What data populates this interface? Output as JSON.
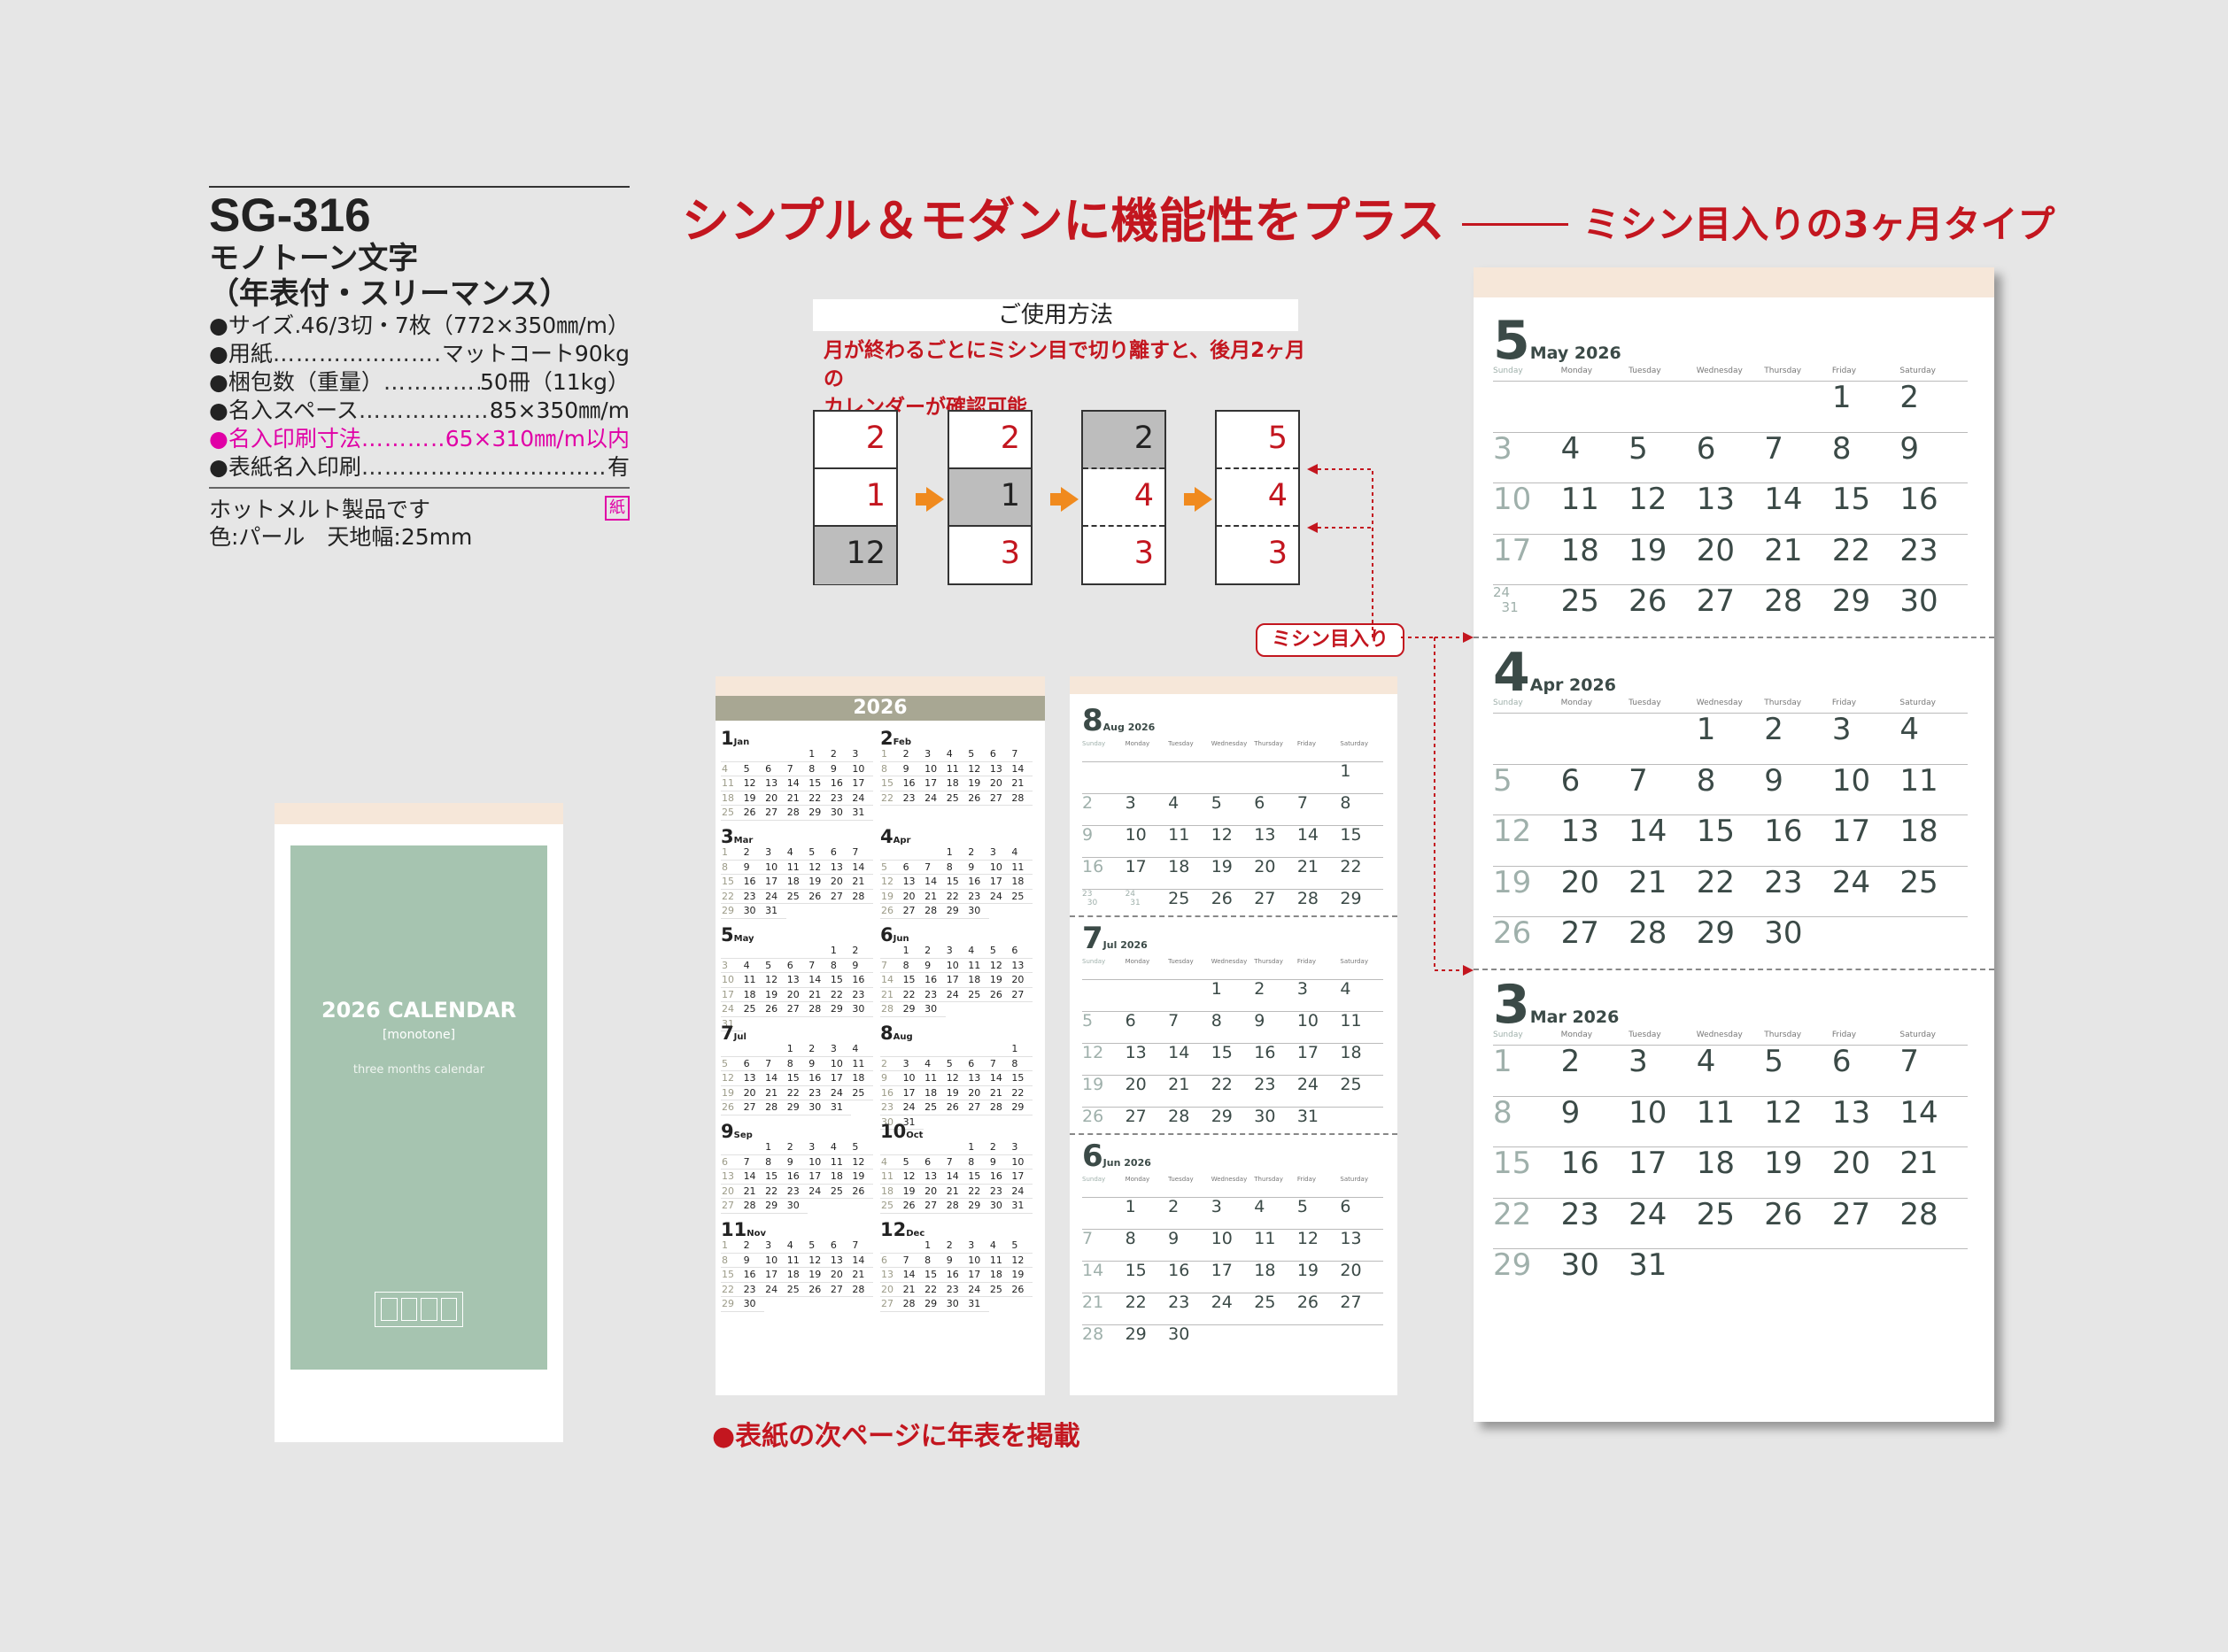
{
  "spec": {
    "code": "SG-316",
    "title1": "モノトーン文字",
    "title2": "（年表付・スリーマンス）",
    "rows": [
      {
        "key": "●サイズ",
        "value": "46/3切・7枚（772×350㎜/m）"
      },
      {
        "key": "●用紙",
        "value": "マットコート90kg"
      },
      {
        "key": "●梱包数（重量）",
        "value": "50冊（11kg）"
      },
      {
        "key": "●名入スペース",
        "value": "85×350㎜/m"
      },
      {
        "key": "●名入印刷寸法",
        "value": "65×310㎜/m以内",
        "highlight": true
      },
      {
        "key": "●表紙名入印刷",
        "value": "有"
      }
    ],
    "note1": "ホットメルト製品です",
    "note2": "色:パール　天地幅:25mm",
    "badge": "紙"
  },
  "headline": {
    "main": "シンプル＆モダンに機能性をプラス",
    "sub": "ミシン目入りの3ヶ月タイプ"
  },
  "usage": {
    "title": "ご使用方法",
    "desc1": "月が終わるごとにミシン目で切り離すと、後月2ヶ月の",
    "desc2": "カレンダーが確認可能",
    "perforation_label": "ミシン目入り",
    "steps": [
      [
        "2",
        "1",
        "12"
      ],
      [
        "2",
        "1",
        "3"
      ],
      [
        "2",
        "4",
        "3"
      ],
      [
        "5",
        "4",
        "3"
      ]
    ]
  },
  "cover": {
    "title": "2026 CALENDAR",
    "brand": "[monotone]",
    "subtitle": "three months calendar"
  },
  "year_sheet": {
    "year": "2026",
    "months": [
      {
        "n": "1",
        "e": "Jan",
        "offset": 4,
        "days": 31
      },
      {
        "n": "2",
        "e": "Feb",
        "offset": 0,
        "days": 28
      },
      {
        "n": "3",
        "e": "Mar",
        "offset": 0,
        "days": 31
      },
      {
        "n": "4",
        "e": "Apr",
        "offset": 3,
        "days": 30
      },
      {
        "n": "5",
        "e": "May",
        "offset": 5,
        "days": 31
      },
      {
        "n": "6",
        "e": "Jun",
        "offset": 1,
        "days": 30
      },
      {
        "n": "7",
        "e": "Jul",
        "offset": 3,
        "days": 31
      },
      {
        "n": "8",
        "e": "Aug",
        "offset": 6,
        "days": 31
      },
      {
        "n": "9",
        "e": "Sep",
        "offset": 2,
        "days": 30
      },
      {
        "n": "10",
        "e": "Oct",
        "offset": 4,
        "days": 31
      },
      {
        "n": "11",
        "e": "Nov",
        "offset": 0,
        "days": 30
      },
      {
        "n": "12",
        "e": "Dec",
        "offset": 2,
        "days": 31
      }
    ]
  },
  "weekdays": [
    "Sunday",
    "Monday",
    "Tuesday",
    "Wednesday",
    "Thursday",
    "Friday",
    "Saturday"
  ],
  "small_sheet": [
    {
      "n": "8",
      "e": "Aug 2026",
      "offset": 6,
      "days": 31,
      "stack": [
        [
          23,
          30
        ],
        [
          24,
          31
        ]
      ]
    },
    {
      "n": "7",
      "e": "Jul 2026",
      "offset": 3,
      "days": 31,
      "stack": []
    },
    {
      "n": "6",
      "e": "Jun 2026",
      "offset": 1,
      "days": 30,
      "stack": []
    }
  ],
  "big_sheet": [
    {
      "n": "5",
      "e": "May 2026",
      "offset": 5,
      "days": 31,
      "stack": [
        [
          24,
          31
        ]
      ]
    },
    {
      "n": "4",
      "e": "Apr 2026",
      "offset": 3,
      "days": 30,
      "stack": []
    },
    {
      "n": "3",
      "e": "Mar 2026",
      "offset": 0,
      "days": 31,
      "stack": []
    }
  ],
  "bottom_note": "●表紙の次ページに年表を掲載",
  "colors": {
    "red": "#c3161f",
    "pink": "#e000a6",
    "orange": "#f08a1e",
    "sage": "#a6c4b0",
    "khaki": "#a8a793"
  }
}
